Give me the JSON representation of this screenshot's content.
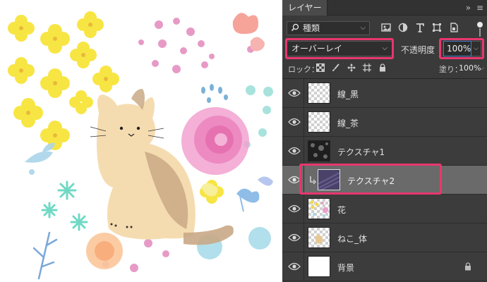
{
  "tab": {
    "label": "レイヤー"
  },
  "filter": {
    "selected": "種類"
  },
  "blend": {
    "selected": "オーバーレイ"
  },
  "opacity": {
    "label": "不透明度",
    "value": "100%"
  },
  "lock": {
    "label": "ロック："
  },
  "fill": {
    "label": "塗り：",
    "value": "100%"
  },
  "layers": [
    {
      "name": "線_黒"
    },
    {
      "name": "線_茶"
    },
    {
      "name": "テクスチャ1"
    },
    {
      "name": "テクスチャ2"
    },
    {
      "name": "花"
    },
    {
      "name": "ねこ_体"
    },
    {
      "name": "背景"
    }
  ],
  "colors": {
    "panel_bg": "#3a3a3a",
    "selected_row": "#6a6a6a",
    "highlight": "#e8376e",
    "opacity_focus": "#3f80c8"
  },
  "icons": [
    "search-icon",
    "eye-icon",
    "lock-icon",
    "clipping-mask-icon",
    "menu-icon"
  ]
}
